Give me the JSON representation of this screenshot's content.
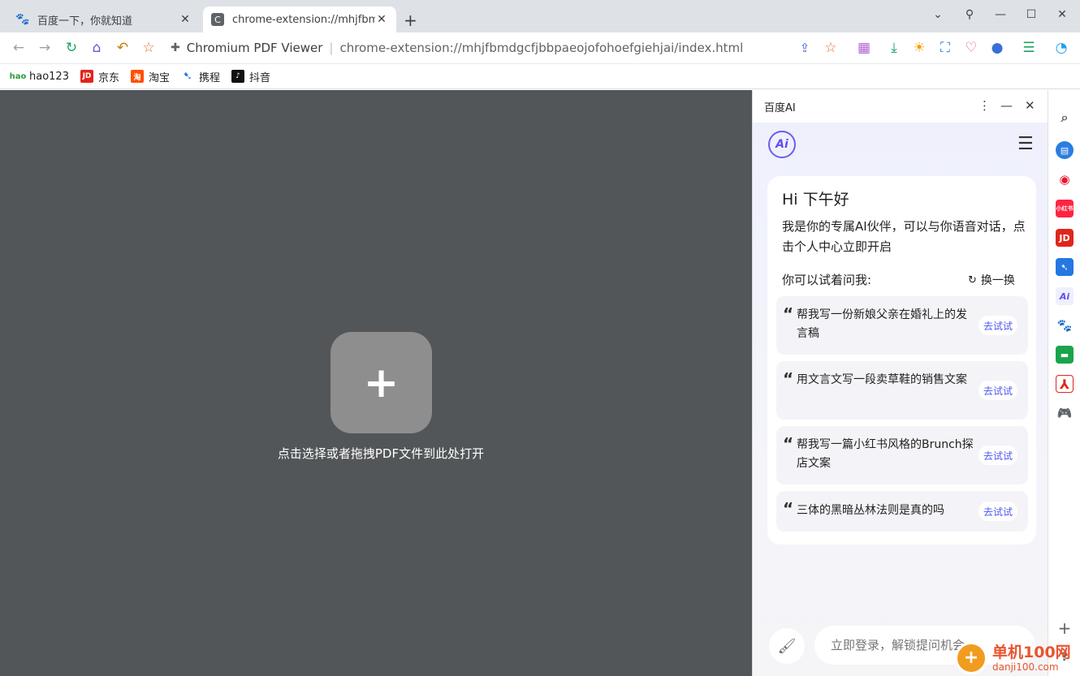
{
  "tabs": [
    {
      "title": "百度一下，你就知道",
      "favicon": "baidu-paw-icon"
    },
    {
      "title": "chrome-extension://mhjfbmdg",
      "favicon": "C"
    }
  ],
  "toolbar": {
    "extension_name": "Chromium PDF Viewer",
    "url": "chrome-extension://mhjfbmdgcfjbbpaeojofohoefgiehjai/index.html"
  },
  "bookmarks": [
    {
      "label": "hao123",
      "icon": "hao"
    },
    {
      "label": "京东",
      "icon": "JD"
    },
    {
      "label": "淘宝",
      "icon": "淘"
    },
    {
      "label": "携程",
      "icon": ""
    },
    {
      "label": "抖音",
      "icon": ""
    }
  ],
  "viewer": {
    "plus": "+",
    "hint": "点击选择或者拖拽PDF文件到此处打开"
  },
  "ai": {
    "panel_title": "百度AI",
    "logo": "Ai",
    "greeting": "Hi 下午好",
    "intro": "我是你的专属AI伙伴，可以与你语音对话，点击个人中心立即开启",
    "try_label": "你可以试着问我:",
    "refresh": "换一换",
    "try_button": "去试试",
    "suggestions": [
      "帮我写一份新娘父亲在婚礼上的发言稿",
      "用文言文写一段卖草鞋的销售文案",
      "帮我写一篇小红书风格的Brunch探店文案",
      "三体的黑暗丛林法则是真的吗"
    ],
    "input_placeholder": "立即登录，解锁提问机会"
  },
  "sidebar_icons": [
    "search-icon",
    "note-icon",
    "weibo-icon",
    "xiaohongshu-icon",
    "jd-icon",
    "ctrip-icon",
    "baidu-ai-icon",
    "baidu-icon",
    "files-icon",
    "pdf-icon",
    "game-icon",
    "add-icon",
    "help-icon"
  ],
  "watermark": {
    "main": "单机100网",
    "sub": "danji100.com"
  },
  "colors": {
    "accent": "#4e57f0",
    "viewer_bg": "#525659",
    "tab_strip": "#dee1e6"
  }
}
